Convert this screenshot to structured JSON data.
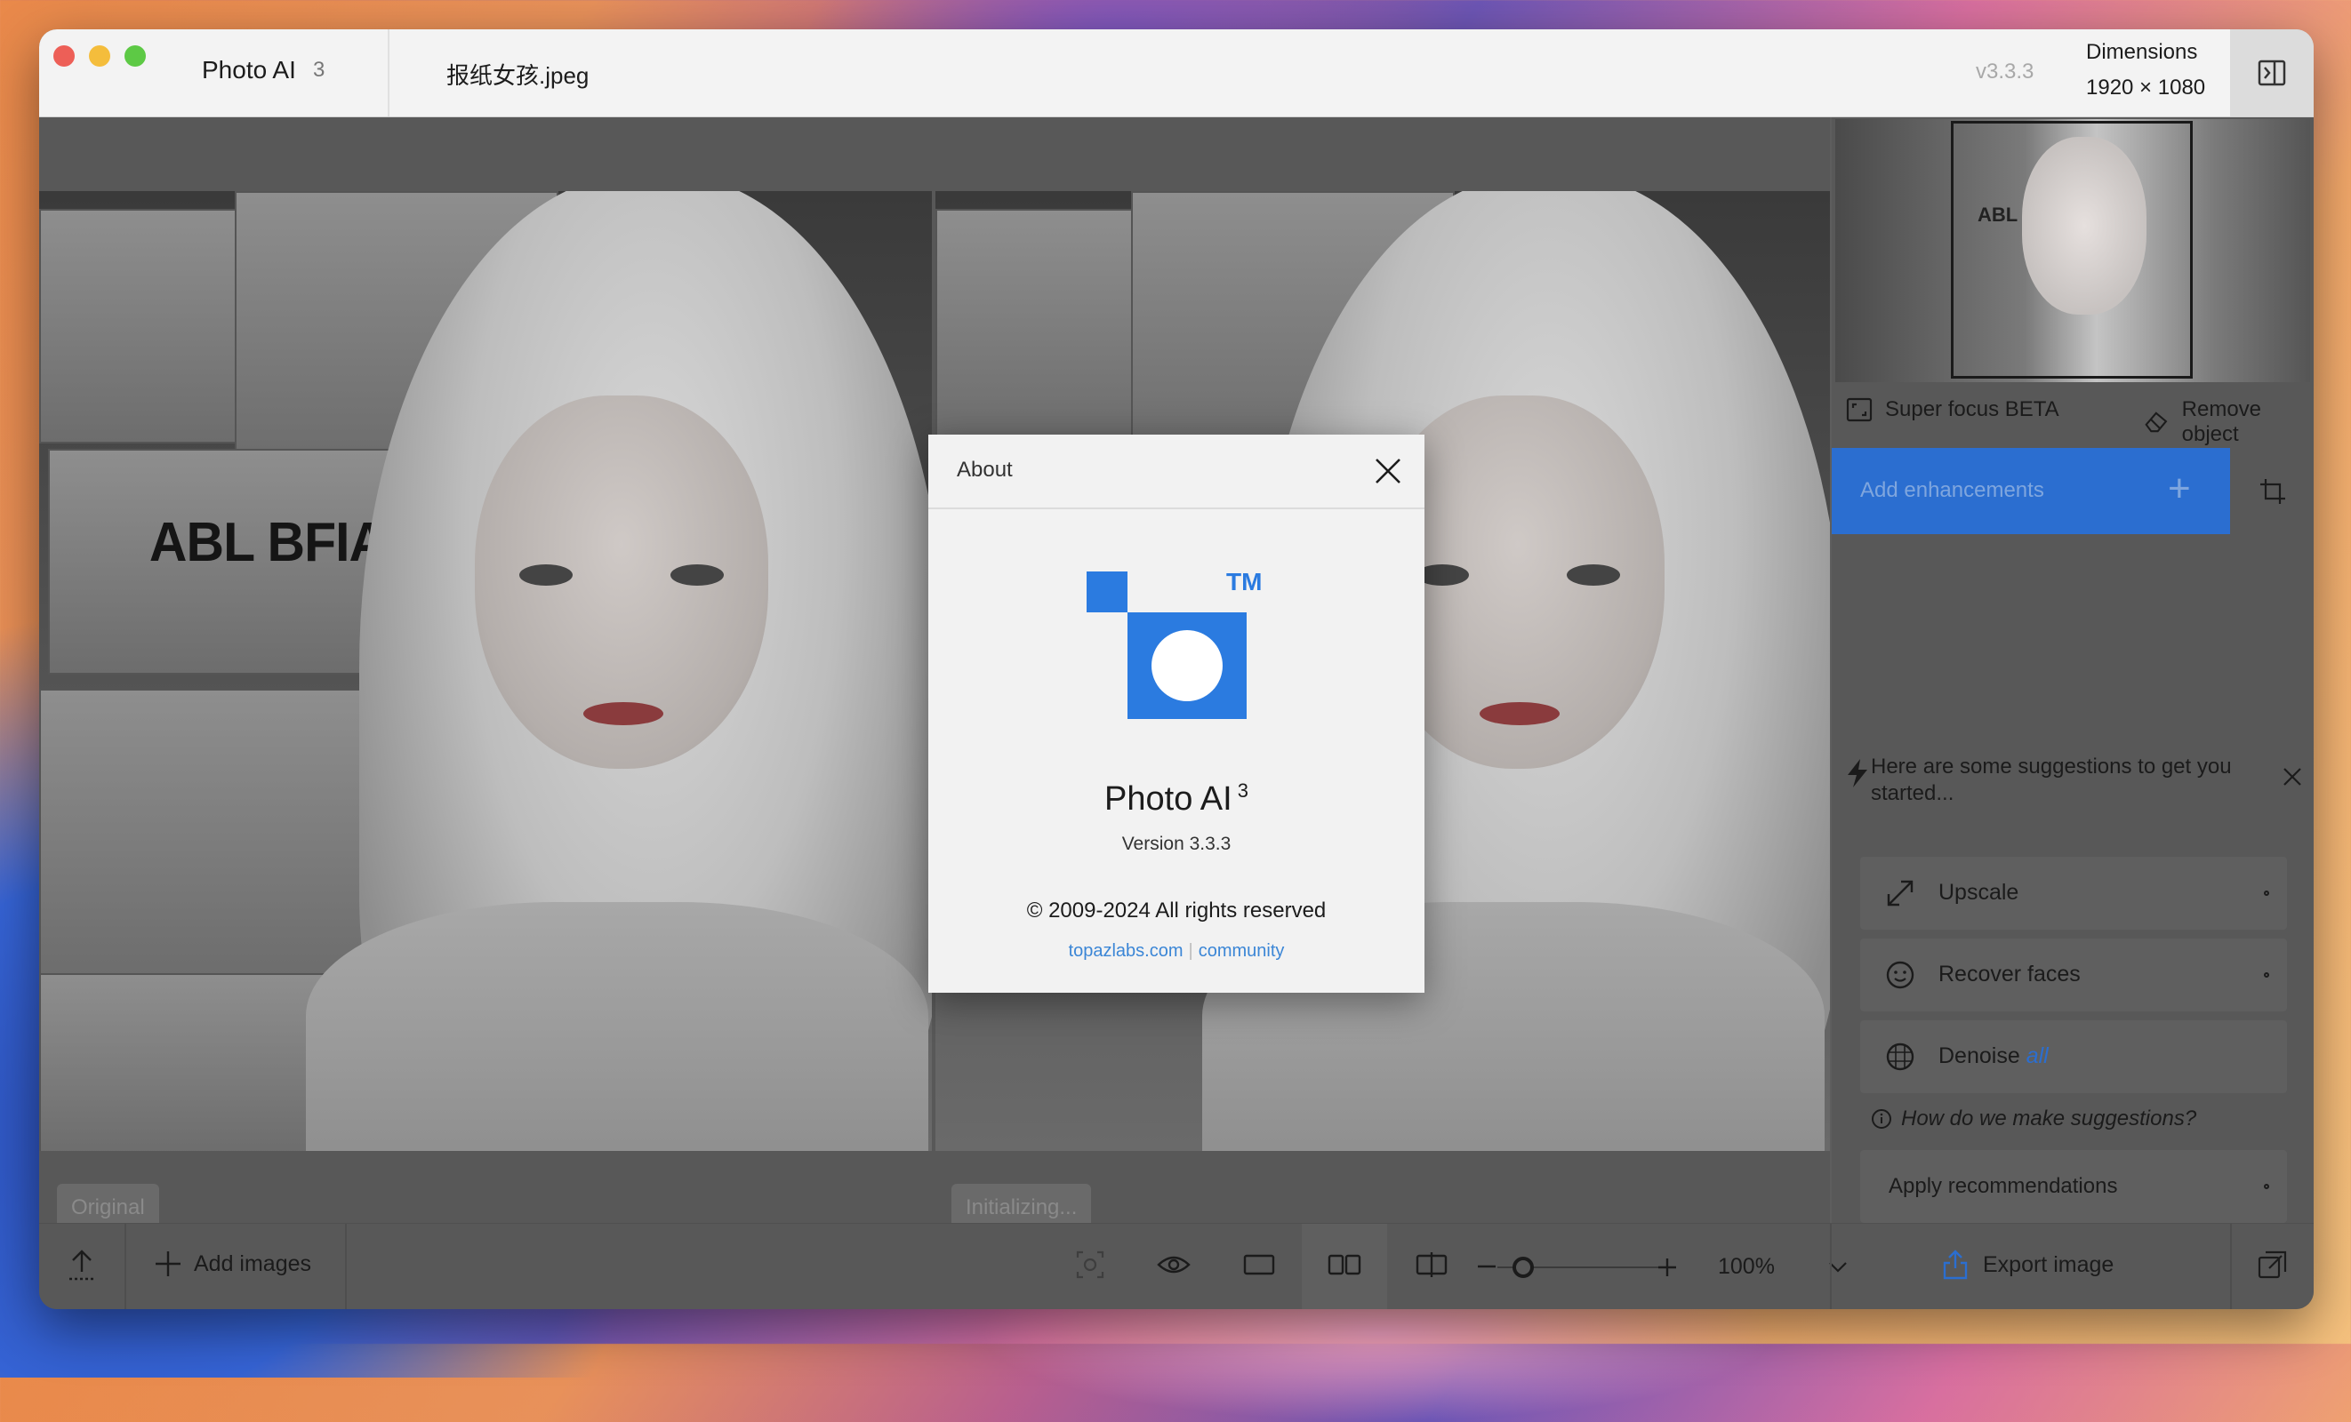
{
  "titlebar": {
    "app_name": "Photo AI",
    "app_version_num": "3",
    "file_name": "报纸女孩.jpeg",
    "version": "v3.3.3",
    "dimensions_label": "Dimensions",
    "dimensions_value": "1920 × 1080"
  },
  "canvas": {
    "left_tag": "Original",
    "right_tag": "Initializing...",
    "headline": "ABL BFIAEF"
  },
  "sidepanel": {
    "thumb_text": "ABL BFIAEF",
    "super_focus": "Super focus BETA",
    "remove_object": "Remove object",
    "add_enhancements": "Add enhancements",
    "suggestion_text": "Here are some suggestions to get you started...",
    "suggestions": [
      {
        "label": "Upscale",
        "icon": "expand-arrow-icon",
        "note": ""
      },
      {
        "label": "Recover faces",
        "icon": "smiley-face-icon",
        "note": ""
      },
      {
        "label": "Denoise",
        "icon": "noise-grid-icon",
        "note": "all"
      }
    ],
    "how_text": "How do we make suggestions?",
    "apply_label": "Apply recommendations"
  },
  "bottombar": {
    "add_images": "Add images",
    "zoom": "100%",
    "zoom_level": 0.15,
    "export": "Export image"
  },
  "about": {
    "title": "About",
    "tm": "TM",
    "product": "Photo AI",
    "product_sup": "3",
    "version": "Version 3.3.3",
    "copyright": "© 2009-2024 All rights reserved",
    "link_site": "topazlabs.com",
    "link_sep": "|",
    "link_community": "community"
  },
  "colors": {
    "accent": "#2b6ed0",
    "logo_blue": "#2b7be0",
    "dim_canvas": "#585858"
  }
}
